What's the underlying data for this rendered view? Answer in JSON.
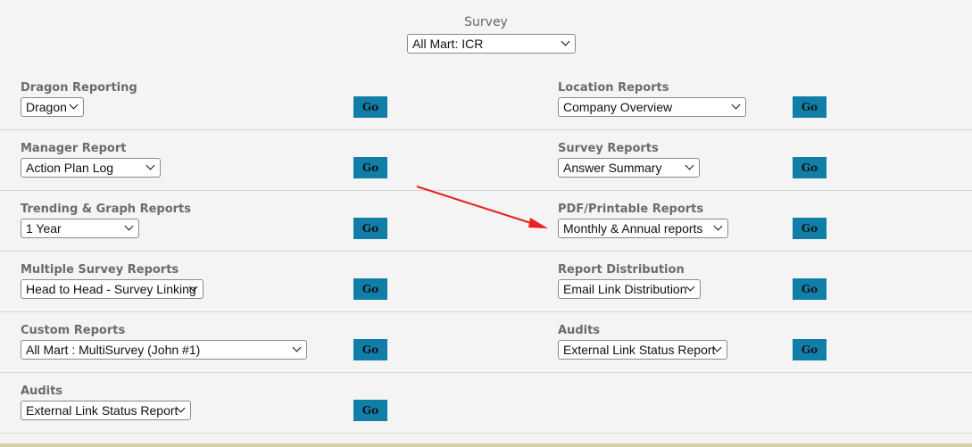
{
  "survey": {
    "label": "Survey",
    "selected": "All Mart: ICR"
  },
  "go_label": "Go",
  "accent_color": "#117ea8",
  "rows": [
    {
      "left": {
        "label": "Dragon Reporting",
        "value": "Dragon"
      },
      "right": {
        "label": "Location Reports",
        "value": "Company Overview"
      }
    },
    {
      "left": {
        "label": "Manager Report",
        "value": "Action Plan Log"
      },
      "right": {
        "label": "Survey Reports",
        "value": "Answer Summary"
      }
    },
    {
      "left": {
        "label": "Trending & Graph Reports",
        "value": "1 Year"
      },
      "right": {
        "label": "PDF/Printable Reports",
        "value": "Monthly & Annual reports"
      }
    },
    {
      "left": {
        "label": "Multiple Survey Reports",
        "value": "Head to Head - Survey Linking"
      },
      "right": {
        "label": "Report Distribution",
        "value": "Email Link Distribution"
      }
    },
    {
      "left": {
        "label": "Custom Reports",
        "value": "All Mart : MultiSurvey (John #1)"
      },
      "right": {
        "label": "Audits",
        "value": "External Link Status Report"
      }
    },
    {
      "left": {
        "label": "Audits",
        "value": "External Link Status Report"
      }
    }
  ],
  "annotation": {
    "icon": "red-arrow-icon",
    "color": "#e8201e"
  }
}
